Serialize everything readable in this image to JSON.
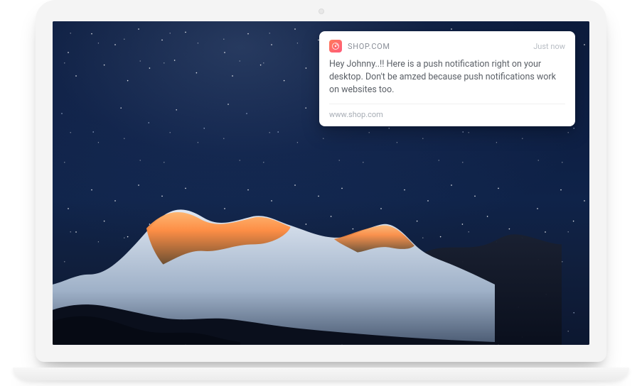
{
  "laptop": {
    "camera_label": "camera"
  },
  "notification": {
    "app_name": "SHOP.COM",
    "app_icon_name": "app-icon",
    "timestamp": "Just now",
    "message": "Hey Johnny..!! Here is a push notification right on your desktop. Don't be amzed because push notifications work on websites too.",
    "source": "www.shop.com"
  }
}
